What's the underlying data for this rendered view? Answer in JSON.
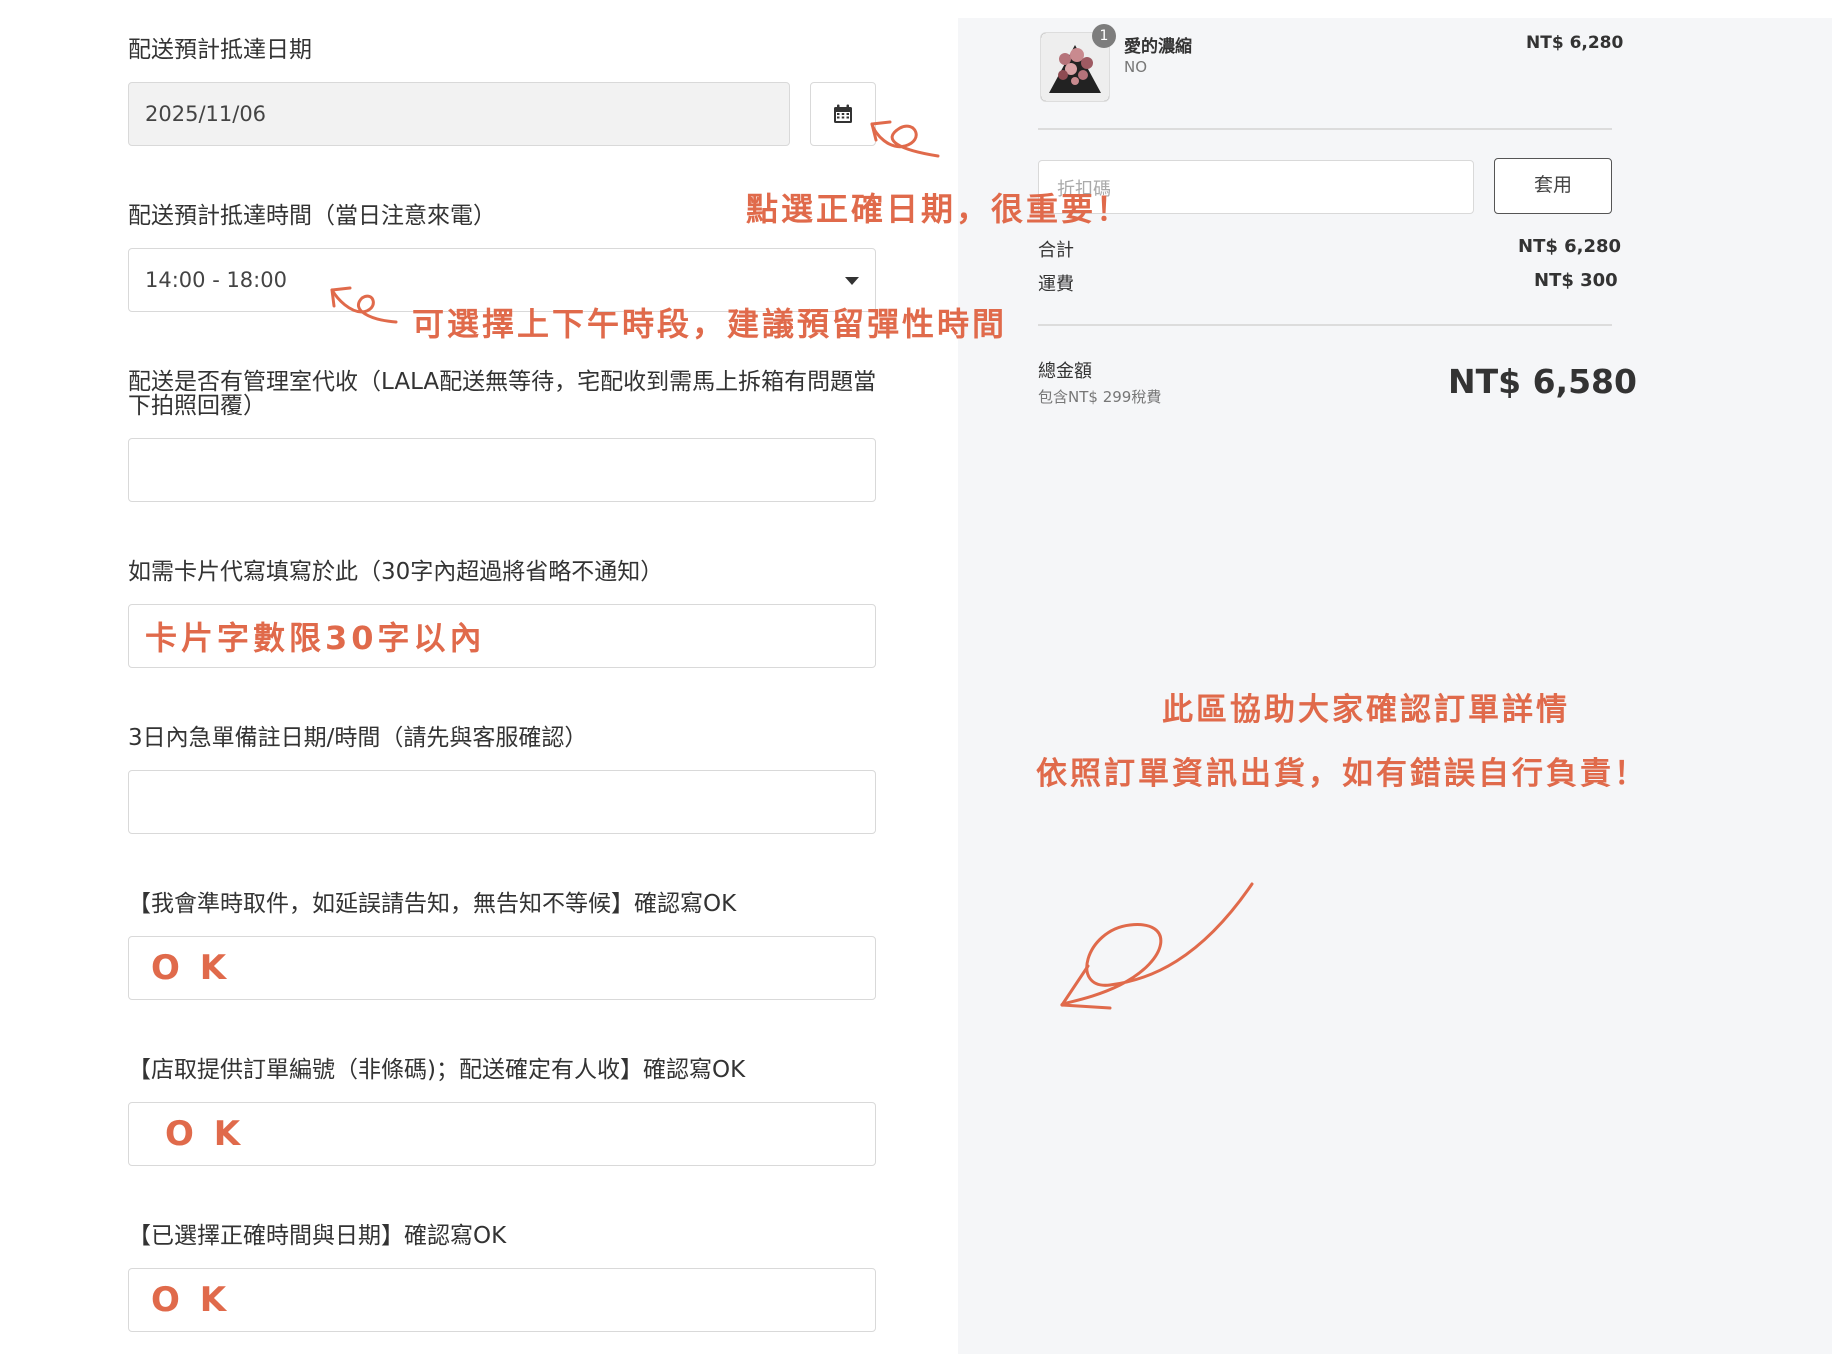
{
  "form": {
    "date_label": "配送預計抵達日期",
    "date_value": "2025/11/06",
    "calendar_icon": "calendar-icon",
    "time_label": "配送預計抵達時間（當日注意來電）",
    "time_value": "14:00 - 18:00",
    "management_label": "配送是否有管理室代收（LALA配送無等待，宅配收到需馬上拆箱有問題當下拍照回覆）",
    "management_value": "",
    "card_label": "如需卡片代寫填寫於此（30字內超過將省略不通知）",
    "card_value": "卡片字數限30字以內",
    "urgent_label": "3日內急單備註日期/時間（請先與客服確認）",
    "urgent_value": "",
    "pickup_label": "【我會準時取件，如延誤請告知，無告知不等候】確認寫OK",
    "pickup_value": "O K",
    "order_no_label": "【店取提供訂單編號（非條碼)；配送確定有人收】確認寫OK",
    "order_no_value": "O K",
    "confirm_label": "【已選擇正確時間與日期】確認寫OK",
    "confirm_value": "O K"
  },
  "annotations": {
    "date_note": "點選正確日期，很重要！",
    "time_note": "可選擇上下午時段，建議預留彈性時間",
    "summary_note_1": "此區協助大家確認訂單詳情",
    "summary_note_2": "依照訂單資訊出貨，如有錯誤自行負責！"
  },
  "summary": {
    "item": {
      "quantity": "1",
      "name": "愛的濃縮",
      "variant": "NO",
      "price": "NT$ 6,280"
    },
    "coupon_placeholder": "折扣碼",
    "apply_label": "套用",
    "subtotal_label": "合計",
    "subtotal_value": "NT$ 6,280",
    "shipping_label": "運費",
    "shipping_value": "NT$ 300",
    "total_label": "總金額",
    "tax_note": "包含NT$ 299稅費",
    "total_value": "NT$ 6,580"
  },
  "colors": {
    "annotation": "#e06a4b",
    "panel_bg": "#f5f6f8"
  }
}
